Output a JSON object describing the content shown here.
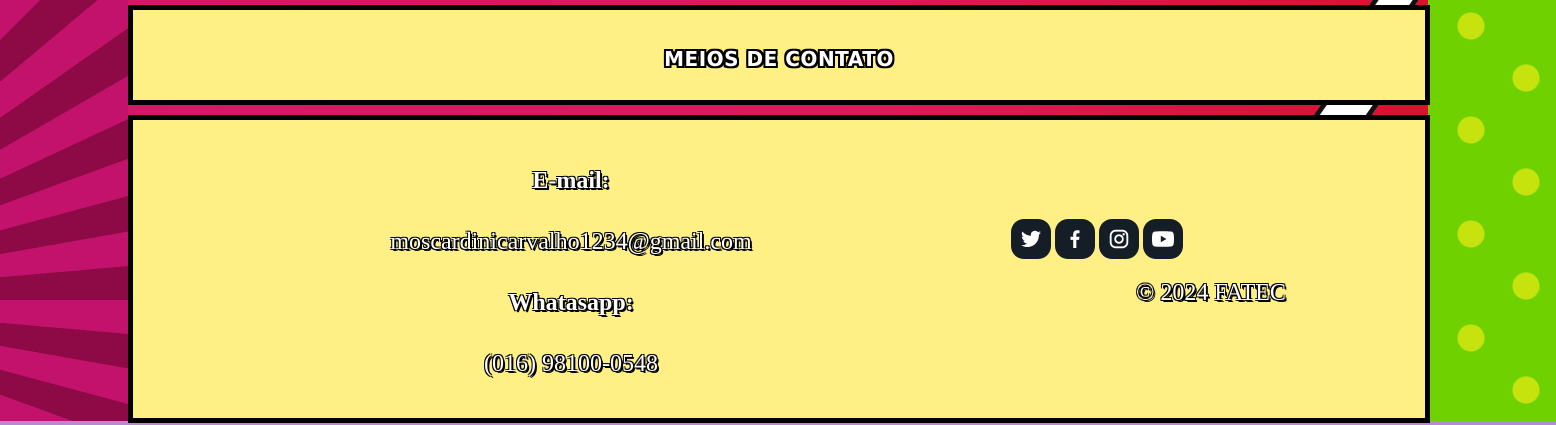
{
  "section": {
    "title": "MEIOS DE CONTATO"
  },
  "contact": {
    "email_label": "E-mail:",
    "email_value": "moscardinicarvalho1234@gmail.com",
    "whatsapp_label": "Whatasapp:",
    "whatsapp_value": "(016) 98100-0548"
  },
  "socials": [
    {
      "name": "twitter",
      "icon": "twitter-icon"
    },
    {
      "name": "facebook",
      "icon": "facebook-icon"
    },
    {
      "name": "instagram",
      "icon": "instagram-icon"
    },
    {
      "name": "youtube",
      "icon": "youtube-icon"
    }
  ],
  "footer": {
    "copyright": "© 2024 FATEC"
  },
  "colors": {
    "card_bg": "#fff085",
    "card_border": "#000000",
    "social_bg": "#151d26",
    "bg_magenta": "#c2126b",
    "bg_green": "#6fd200",
    "dot_yellow": "#c6e30d"
  }
}
